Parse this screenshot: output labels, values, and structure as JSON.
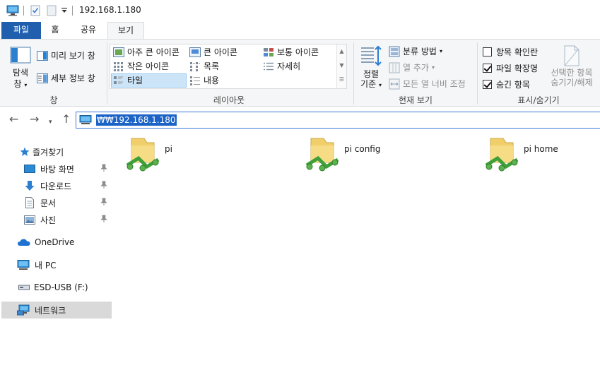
{
  "window": {
    "title": "192.168.1.180"
  },
  "tabs": [
    {
      "label": "파일"
    },
    {
      "label": "홈"
    },
    {
      "label": "공유"
    },
    {
      "label": "보기"
    }
  ],
  "ribbon": {
    "pane_group": {
      "label": "창",
      "nav_pane_label_line1": "탐색",
      "nav_pane_label_line2": "창",
      "preview_label": "미리 보기 창",
      "details_label": "세부 정보 창"
    },
    "layout_group": {
      "label": "레이아웃",
      "items": [
        {
          "label": "아주 큰 아이콘",
          "icon": "extra-large-icons-icon"
        },
        {
          "label": "큰 아이콘",
          "icon": "large-icons-icon"
        },
        {
          "label": "보통 아이콘",
          "icon": "medium-icons-icon"
        },
        {
          "label": "작은 아이콘",
          "icon": "small-icons-icon"
        },
        {
          "label": "목록",
          "icon": "list-icon"
        },
        {
          "label": "자세히",
          "icon": "details-icon"
        },
        {
          "label": "타일",
          "icon": "tiles-icon",
          "selected": true
        },
        {
          "label": "내용",
          "icon": "content-icon"
        }
      ]
    },
    "current_view_group": {
      "label": "현재 보기",
      "sort_label_line1": "정렬",
      "sort_label_line2": "기준",
      "group_by_label": "분류 방법",
      "add_columns_label": "열 추가",
      "fit_columns_label": "모든 열 너비 조정"
    },
    "show_hide_group": {
      "label": "표시/숨기기",
      "item_checkboxes": {
        "label": "항목 확인란",
        "checked": false
      },
      "file_extensions": {
        "label": "파일 확장명",
        "checked": true
      },
      "hidden_items": {
        "label": "숨긴 항목",
        "checked": true
      },
      "hide_selected_line1": "선택한 항목",
      "hide_selected_line2": "숨기기/해제"
    }
  },
  "address_bar": {
    "value": "₩₩192.168.1.180"
  },
  "nav_pane": {
    "quick_access": "즐겨찾기",
    "pinned": [
      {
        "label": "바탕 화면",
        "icon": "desktop-icon"
      },
      {
        "label": "다운로드",
        "icon": "downloads-icon"
      },
      {
        "label": "문서",
        "icon": "documents-icon"
      },
      {
        "label": "사진",
        "icon": "pictures-icon"
      }
    ],
    "onedrive": "OneDrive",
    "this_pc": "내 PC",
    "usb": "ESD-USB (F:)",
    "network": "네트워크"
  },
  "content": {
    "items": [
      {
        "name": "pi"
      },
      {
        "name": "pi config"
      },
      {
        "name": "pi home"
      }
    ]
  }
}
